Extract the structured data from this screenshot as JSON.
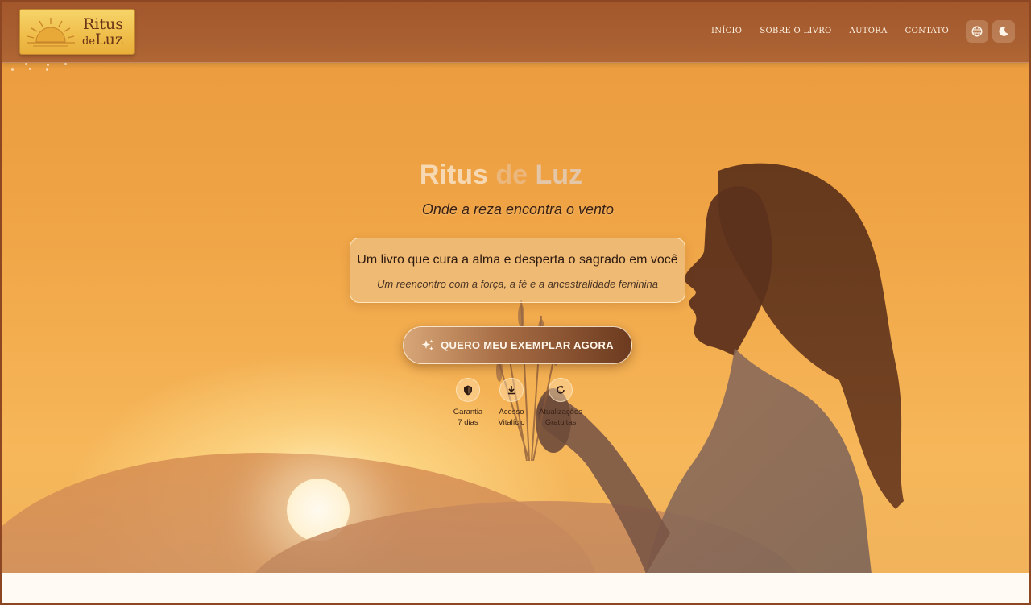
{
  "brand": {
    "logo_line1": "Ritus",
    "logo_line2_small": "de",
    "logo_line2": "Luz"
  },
  "nav": {
    "items": [
      {
        "label": "INÍCIO"
      },
      {
        "label": "SOBRE O LIVRO"
      },
      {
        "label": "AUTORA"
      },
      {
        "label": "CONTATO"
      }
    ],
    "language_icon": "globe-icon",
    "theme_icon": "moon-icon"
  },
  "hero": {
    "title_part1": "Ritus",
    "title_part2": "de",
    "title_part3": "Luz",
    "tagline": "Onde a reza encontra o vento",
    "card_heading": "Um livro que cura a alma e desperta o sagrado em você",
    "card_subheading": "Um reencontro com a força, a fé e a ancestralidade feminina",
    "cta_label": "QUERO MEU EXEMPLAR AGORA",
    "cta_icon": "sparkles-icon"
  },
  "features": [
    {
      "icon": "shield-icon",
      "line1": "Garantia",
      "line2": "7 dias"
    },
    {
      "icon": "download-icon",
      "line1": "Acesso",
      "line2": "Vitalício"
    },
    {
      "icon": "refresh-icon",
      "line1": "Atualizações",
      "line2": "Gratuitas"
    }
  ],
  "colors": {
    "header": "#a85f31",
    "sky": "#efa344",
    "logo_gold": "#f0bf4c",
    "text_dark": "#2e1a10"
  }
}
